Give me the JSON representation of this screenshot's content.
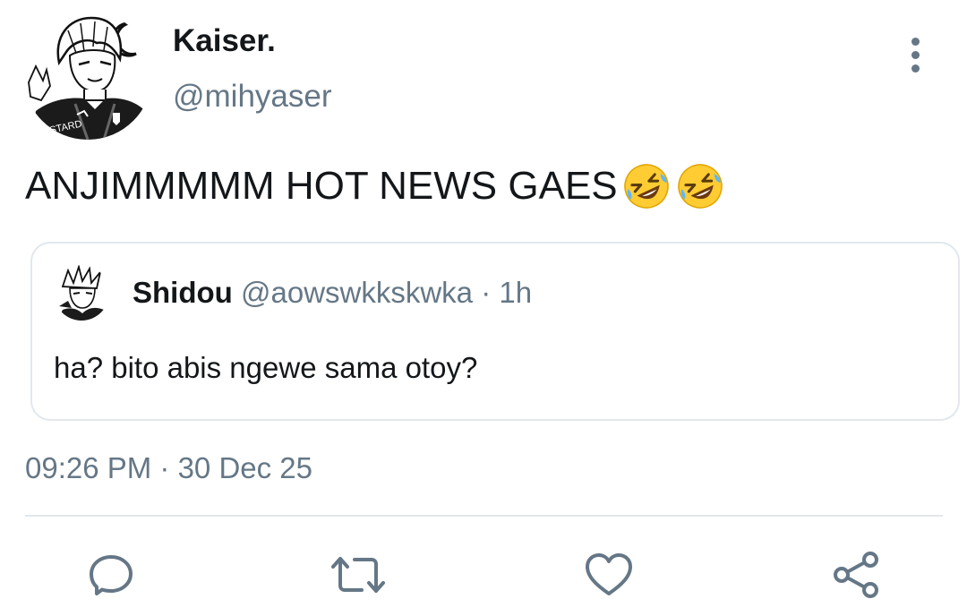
{
  "tweet": {
    "author": {
      "display_name": "Kaiser.",
      "handle": "@mihyaser",
      "avatar_icon": "manga-avatar-icon",
      "avatar_jersey_text": "BASTARD"
    },
    "more_icon": "more-vertical-icon",
    "text": "ANJIMMMMM HOT NEWS GAES",
    "emojis": [
      "rolling-on-floor-laughing",
      "rolling-on-floor-laughing"
    ],
    "quote": {
      "display_name": "Shidou",
      "handle": "@aowswkkskwka",
      "separator": "·",
      "time": "1h",
      "text": "ha? bito abis ngewe sama otoy?"
    },
    "timestamp": "09:26 PM · 30 Dec 25"
  },
  "actions": {
    "reply_icon": "reply-icon",
    "retweet_icon": "retweet-icon",
    "like_icon": "heart-icon",
    "share_icon": "share-icon"
  },
  "colors": {
    "text_primary": "#14171a",
    "text_secondary": "#657786",
    "border": "#e1e8ed",
    "emoji_yellow": "#ffcc33"
  }
}
